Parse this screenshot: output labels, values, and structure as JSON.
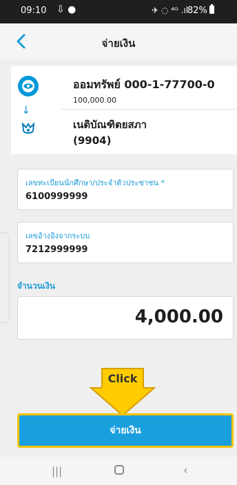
{
  "status_bar": {
    "time": "09:10",
    "left_icons": "⇩ ●",
    "right_icons": "✈ ◌ ⁴ᴳ .ıl",
    "battery": "82%"
  },
  "header": {
    "title": "จ่ายเงิน",
    "back_icon": "chevron-left-icon"
  },
  "transfer": {
    "from_account": "ออมทรัพย์ 000-1-77700-0",
    "from_balance": "100,000.00",
    "arrow": "↓",
    "to_name": "เนติบัณฑิตยสภา",
    "to_code": "(9904)",
    "from_icon": "bank-logo-icon",
    "to_icon": "payee-logo-icon"
  },
  "form": {
    "student_id_label": "เลขทะเบียนนักศึกษา/ประจำตัวประชาชน *",
    "student_id_value": "6100999999",
    "reference_label": "เลขอ้างอิงจากระบบ",
    "reference_value": "7212999999",
    "amount_label": "จำนวนเงิน",
    "amount_value": "4,000.00"
  },
  "callout": {
    "text": "Click"
  },
  "action": {
    "pay_label": "จ่ายเงิน"
  },
  "nav": {
    "recent_icon": "|||",
    "back_icon": "‹"
  },
  "colors": {
    "accent": "#1a9fde",
    "highlight": "#f4c300",
    "label": "#1a9bd8"
  }
}
